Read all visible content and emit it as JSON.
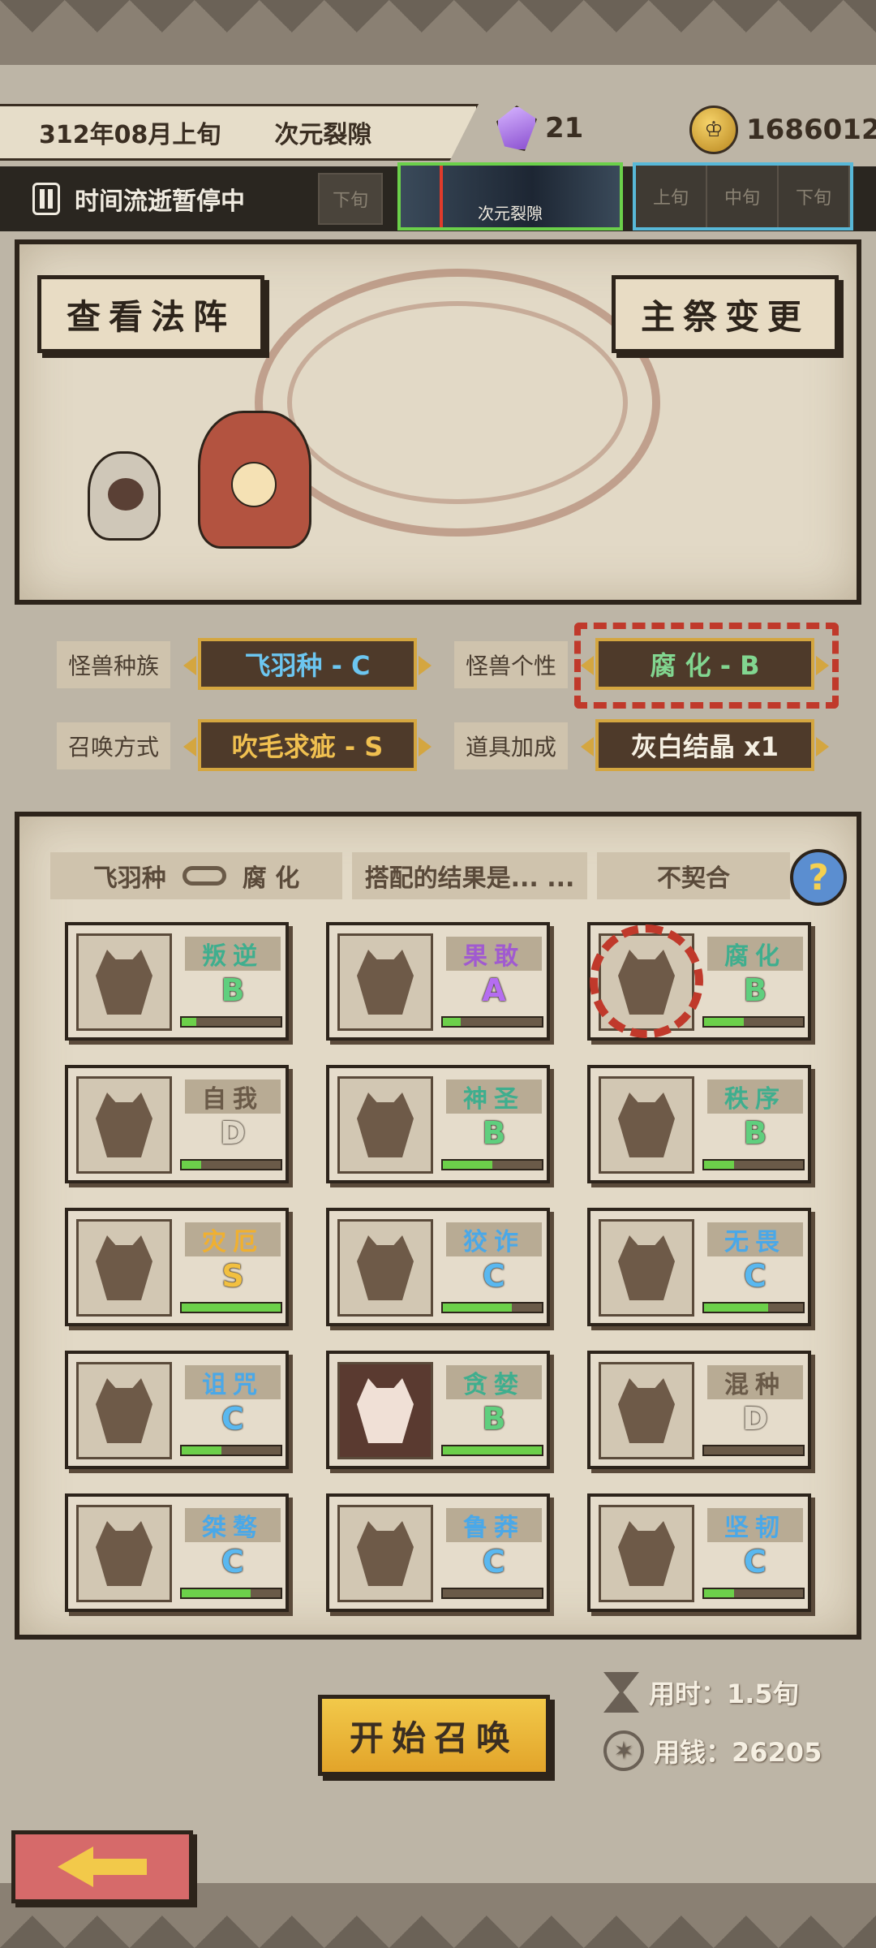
{
  "header": {
    "date": "312年08月上旬",
    "location": "次元裂隙",
    "crystals": "21",
    "coins": "1686012"
  },
  "timeline": {
    "pause_label": "时间流逝暂停中",
    "slot_left": "下旬",
    "current_label": "次元裂隙",
    "next_slots": [
      "上旬",
      "中旬",
      "下旬"
    ]
  },
  "ritual": {
    "view_button": "查看法阵",
    "priest_button": "主祭变更"
  },
  "attributes": {
    "race_label": "怪兽种族",
    "race_value": "飞羽种 - C",
    "trait_label": "怪兽个性",
    "trait_value": "腐 化 - B",
    "method_label": "召唤方式",
    "method_value": "吹毛求疵 - S",
    "item_label": "道具加成",
    "item_value": "灰白结晶 x1"
  },
  "match": {
    "race": "飞羽种",
    "trait": "腐 化",
    "prompt": "搭配的结果是... ...",
    "result": "不契合",
    "help": "?"
  },
  "traits": [
    {
      "name": "叛逆",
      "grade": "B",
      "progress": 0.15
    },
    {
      "name": "果敢",
      "grade": "A",
      "progress": 0.18
    },
    {
      "name": "腐化",
      "grade": "B",
      "progress": 0.4
    },
    {
      "name": "自我",
      "grade": "D",
      "progress": 0.2
    },
    {
      "name": "神圣",
      "grade": "B",
      "progress": 0.5
    },
    {
      "name": "秩序",
      "grade": "B",
      "progress": 0.3
    },
    {
      "name": "灾厄",
      "grade": "S",
      "progress": 1.0
    },
    {
      "name": "狡诈",
      "grade": "C",
      "progress": 0.7
    },
    {
      "name": "无畏",
      "grade": "C",
      "progress": 0.65
    },
    {
      "name": "诅咒",
      "grade": "C",
      "progress": 0.4
    },
    {
      "name": "贪婪",
      "grade": "B",
      "progress": 1.0
    },
    {
      "name": "混种",
      "grade": "D",
      "progress": 0.0
    },
    {
      "name": "桀骜",
      "grade": "C",
      "progress": 0.7
    },
    {
      "name": "鲁莽",
      "grade": "C",
      "progress": 0.0
    },
    {
      "name": "坚韧",
      "grade": "C",
      "progress": 0.3
    }
  ],
  "footer": {
    "start_button": "开始召唤",
    "time_cost": "用时：1.5旬",
    "money_cost": "用钱：26205"
  }
}
